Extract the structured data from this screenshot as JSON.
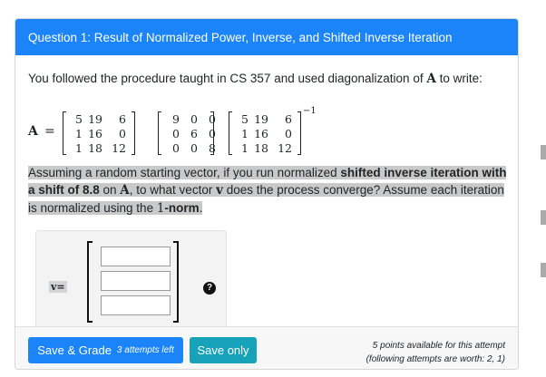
{
  "question": {
    "title": "Question 1: Result of Normalized Power, Inverse, and Shifted Inverse Iteration",
    "intro_before": "You followed the procedure taught in CS 357 and used diagonalization of ",
    "intro_var": "A",
    "intro_after": " to write:",
    "equation": {
      "lhs": "A",
      "equals": "=",
      "inverse_exponent": "−1",
      "matrix_p": [
        [
          "5",
          "19",
          "6"
        ],
        [
          "1",
          "16",
          "0"
        ],
        [
          "1",
          "18",
          "12"
        ]
      ],
      "matrix_d": [
        [
          "9",
          "0",
          "0"
        ],
        [
          "0",
          "6",
          "0"
        ],
        [
          "0",
          "0",
          "8"
        ]
      ],
      "matrix_p_inv": [
        [
          "5",
          "19",
          "6"
        ],
        [
          "1",
          "16",
          "0"
        ],
        [
          "1",
          "18",
          "12"
        ]
      ]
    },
    "text_1": "Assuming a random starting vector, if you run normalized ",
    "text_bold_1": "shifted inverse iteration with a shift of 8.8",
    "text_2": " on ",
    "text_var_a": "A",
    "text_3": ", to what vector ",
    "text_var_v": "v",
    "text_4": " does the process converge? Assume each iteration is normalized using the ",
    "text_norm_num": "1",
    "text_norm": "-norm",
    "text_5": "."
  },
  "answer": {
    "vector_label": "v=",
    "inputs": [
      "",
      "",
      ""
    ],
    "help_icon": "?"
  },
  "footer": {
    "save_grade_label": "Save & Grade",
    "attempts_left": "3 attempts left",
    "save_only_label": "Save only",
    "points_line_1": "5 points available for this attempt",
    "points_line_2": "(following attempts are worth: 2, 1)"
  },
  "colors": {
    "header_bg": "#1a84f8",
    "primary_button": "#1a84f8",
    "info_button": "#16a2b8",
    "highlight": "#c9c9c9"
  }
}
